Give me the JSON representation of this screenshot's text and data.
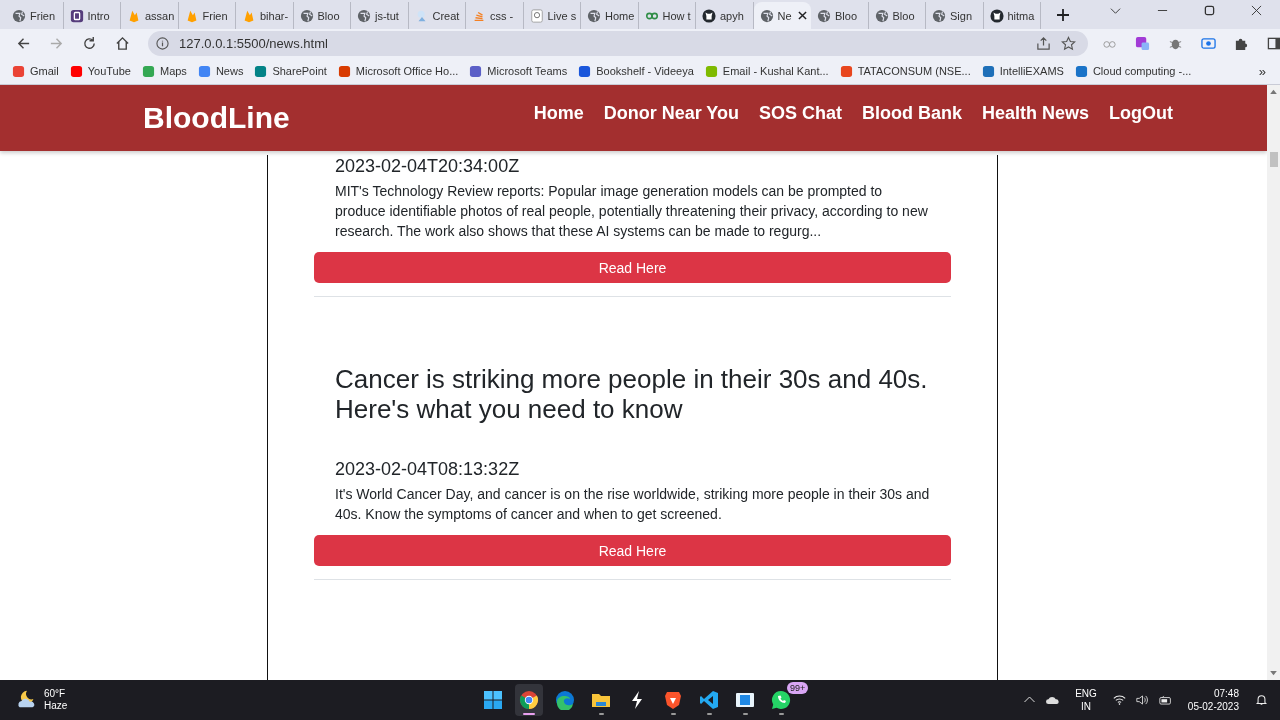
{
  "browser": {
    "tabs": [
      {
        "label": "Frien",
        "kind": "globe",
        "selected": false
      },
      {
        "label": "Intro",
        "kind": "square",
        "selected": false
      },
      {
        "label": "assan",
        "kind": "flame",
        "selected": false
      },
      {
        "label": "Frien",
        "kind": "flame",
        "selected": false
      },
      {
        "label": "bihar-",
        "kind": "flame",
        "selected": false
      },
      {
        "label": "Bloo",
        "kind": "globe",
        "selected": false
      },
      {
        "label": "js-tut",
        "kind": "globe",
        "selected": false
      },
      {
        "label": "Creat",
        "kind": "sketch",
        "selected": false
      },
      {
        "label": "css -",
        "kind": "stack",
        "selected": false
      },
      {
        "label": "Live s",
        "kind": "page",
        "selected": false
      },
      {
        "label": "Home",
        "kind": "globe",
        "selected": false
      },
      {
        "label": "How t",
        "kind": "link",
        "selected": false
      },
      {
        "label": "apyh",
        "kind": "cat",
        "selected": false
      },
      {
        "label": "Ne",
        "kind": "globe",
        "selected": true
      },
      {
        "label": "Bloo",
        "kind": "globe",
        "selected": false
      },
      {
        "label": "Bloo",
        "kind": "globe",
        "selected": false
      },
      {
        "label": "Sign",
        "kind": "globe",
        "selected": false
      },
      {
        "label": "hitma",
        "kind": "cat",
        "selected": false
      }
    ],
    "address": "127.0.0.1:5500/news.html",
    "bookmarks": [
      {
        "label": "Gmail",
        "color": "#ea4335"
      },
      {
        "label": "YouTube",
        "color": "#ff0000"
      },
      {
        "label": "Maps",
        "color": "#34a853"
      },
      {
        "label": "News",
        "color": "#4285f4"
      },
      {
        "label": "SharePoint",
        "color": "#038387"
      },
      {
        "label": "Microsoft Office Ho...",
        "color": "#d83b01"
      },
      {
        "label": "Microsoft Teams",
        "color": "#5b5fc7"
      },
      {
        "label": "Bookshelf - Videeya",
        "color": "#1a56db"
      },
      {
        "label": "Email - Kushal Kant...",
        "color": "#7fba00"
      },
      {
        "label": "TATACONSUM (NSE...",
        "color": "#e8461e"
      },
      {
        "label": "IntelliEXAMS",
        "color": "#1e6fb8"
      },
      {
        "label": "Cloud computing -...",
        "color": "#1a73c8"
      }
    ],
    "more_bookmarks": "»"
  },
  "navbar": {
    "brand": "BloodLine",
    "links": [
      "Home",
      "Donor Near You",
      "SOS Chat",
      "Blood Bank",
      "Health News",
      "LogOut"
    ]
  },
  "articles": [
    {
      "date": "2023-02-04T20:34:00Z",
      "description": "MIT's Technology Review reports: Popular image generation models can be prompted to produce identifiable photos of real people, potentially threatening their privacy, according to new research. The work also shows that these AI systems can be made to regurg...",
      "button": "Read Here"
    },
    {
      "title": "Cancer is striking more people in their 30s and 40s. Here's what you need to know",
      "date": "2023-02-04T08:13:32Z",
      "description": "It's World Cancer Day, and cancer is on the rise worldwide, striking more people in their 30s and 40s. Know the symptoms of cancer and when to get screened.",
      "button": "Read Here"
    }
  ],
  "taskbar": {
    "weather": {
      "temp": "60°F",
      "condition": "Haze"
    },
    "apps": [
      {
        "kind": "start",
        "running": false,
        "selected": false
      },
      {
        "kind": "chrome",
        "running": true,
        "selected": true
      },
      {
        "kind": "edge",
        "running": false,
        "selected": false
      },
      {
        "kind": "folder",
        "running": true,
        "selected": false
      },
      {
        "kind": "bolt",
        "running": false,
        "selected": false
      },
      {
        "kind": "lion",
        "running": true,
        "selected": false
      },
      {
        "kind": "code",
        "running": true,
        "selected": false
      },
      {
        "kind": "film",
        "running": true,
        "selected": false
      },
      {
        "kind": "chat",
        "running": true,
        "selected": false,
        "badge": "99+"
      }
    ],
    "language": "ENG",
    "region": "IN",
    "time": "07:48",
    "date": "05-02-2023"
  }
}
